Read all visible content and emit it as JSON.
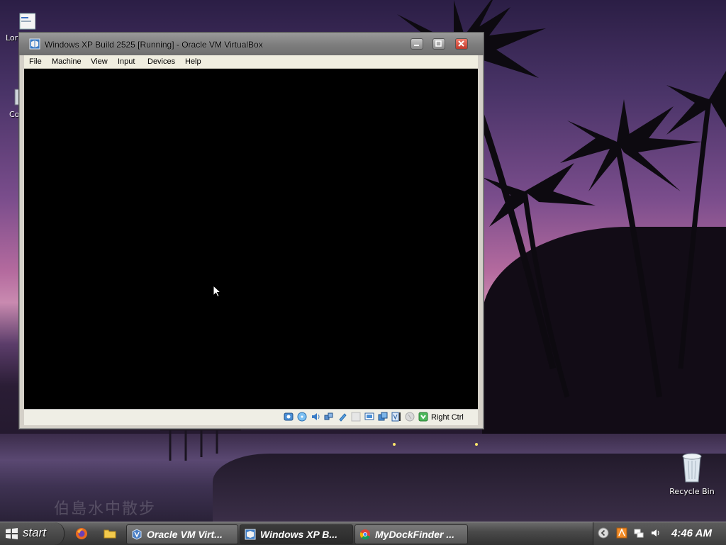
{
  "desktop": {
    "icons": [
      {
        "label": "Lor",
        "icon": "document-icon"
      },
      {
        "label": "Co",
        "icon": "computer-icon"
      },
      {
        "label": "Recycle Bin",
        "icon": "recycle-bin-icon"
      }
    ],
    "watermark": "伯島水中散步"
  },
  "window": {
    "title": "Windows XP Build 2525 [Running] - Oracle VM VirtualBox",
    "menu": [
      "File",
      "Machine",
      "View",
      "Input",
      "Devices",
      "Help"
    ],
    "status_icons": [
      "hard-disk-icon",
      "optical-drive-icon",
      "audio-icon",
      "network-icon",
      "usb-icon",
      "shared-folders-icon",
      "display-icon",
      "video-capture-icon",
      "virtualization-icon",
      "mouse-integration-icon",
      "host-key-icon"
    ],
    "host_key": "Right Ctrl",
    "colors": {
      "close": "#c0392b",
      "screen": "#000000"
    }
  },
  "taskbar": {
    "start_label": "start",
    "quick_launch": [
      "firefox-icon",
      "folder-icon"
    ],
    "tasks": [
      {
        "label": "Oracle VM Virt...",
        "icon": "virtualbox-icon",
        "active": false
      },
      {
        "label": "Windows XP B...",
        "icon": "virtualbox-vm-icon",
        "active": true
      },
      {
        "label": "MyDockFinder ...",
        "icon": "chrome-icon",
        "active": false
      }
    ],
    "tray_icons": [
      "chevron-left-icon",
      "app-tray-icon",
      "network-tray-icon",
      "volume-icon"
    ],
    "clock": "4:46 AM"
  }
}
